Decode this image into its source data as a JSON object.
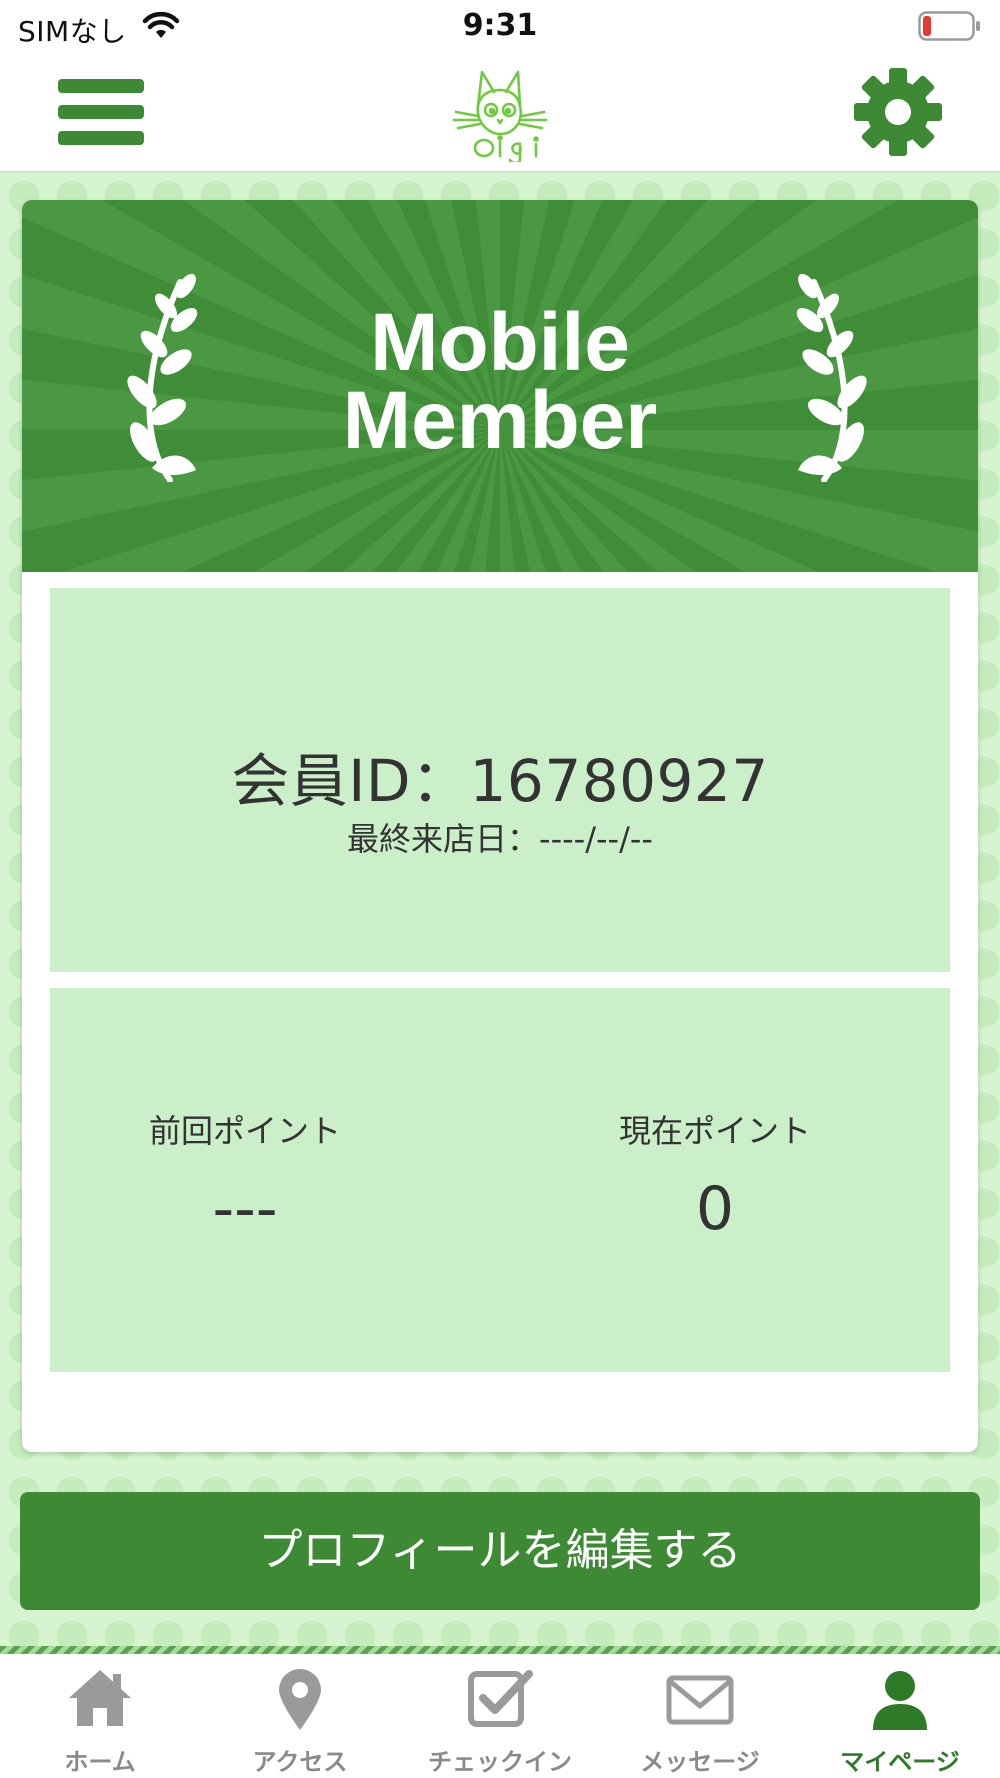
{
  "status_bar": {
    "carrier": "SIMなし",
    "time": "9:31"
  },
  "colors": {
    "brand_green": "#3e8a34",
    "panel_green": "#cbefc8",
    "background_green": "#d6f4d0",
    "battery_low": "#e53935",
    "tab_inactive": "#8a8a8a"
  },
  "header": {
    "logo_text": "Oigi",
    "menu_icon": "hamburger-icon",
    "settings_icon": "gear-icon"
  },
  "card": {
    "banner_line1": "Mobile",
    "banner_line2": "Member",
    "member_id": "会員ID：16780927",
    "last_visit": "最終来店日：----/--/--",
    "points": {
      "previous_label": "前回ポイント",
      "previous_value": "---",
      "current_label": "現在ポイント",
      "current_value": "0"
    }
  },
  "edit_profile_label": "プロフィールを編集する",
  "tabs": [
    {
      "label": "ホーム",
      "icon": "home-icon",
      "active": false
    },
    {
      "label": "アクセス",
      "icon": "map-pin-icon",
      "active": false
    },
    {
      "label": "チェックイン",
      "icon": "checkbox-icon",
      "active": false
    },
    {
      "label": "メッセージ",
      "icon": "envelope-icon",
      "active": false
    },
    {
      "label": "マイページ",
      "icon": "user-icon",
      "active": true
    }
  ]
}
